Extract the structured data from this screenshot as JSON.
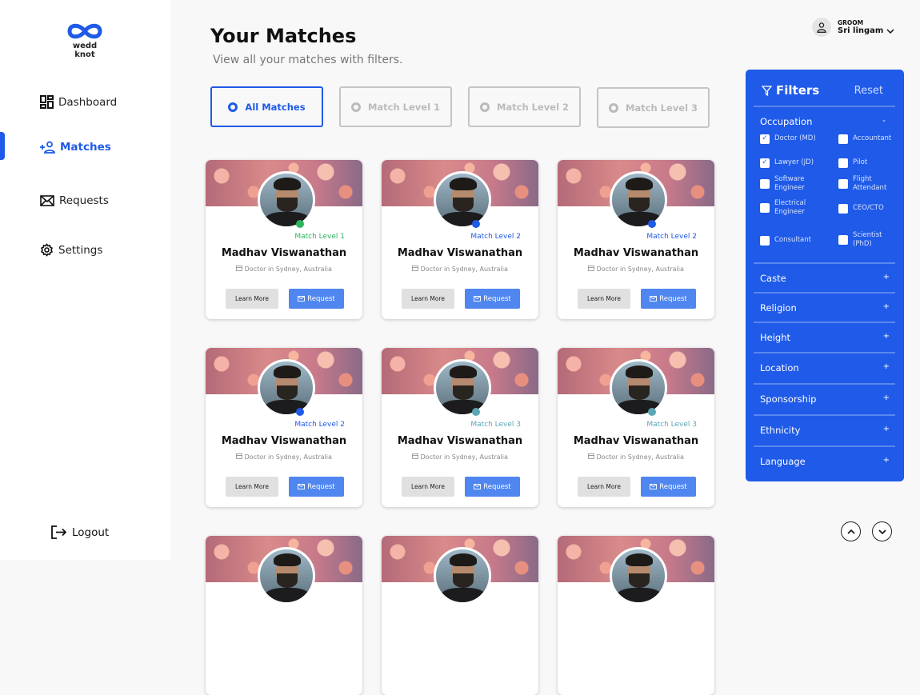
{
  "brand": {
    "name": "wedd knot",
    "color": "#1f5ae8"
  },
  "nav": [
    {
      "label": "Dashboard",
      "icon": "dashboard-icon"
    },
    {
      "label": "Matches",
      "icon": "add-user-icon",
      "active": true
    },
    {
      "label": "Requests",
      "icon": "mail-icon"
    },
    {
      "label": "Settings",
      "icon": "gear-icon"
    }
  ],
  "logout": "Logout",
  "header": {
    "title": "Your Matches",
    "subtitle": "View all your matches with filters."
  },
  "user": {
    "role": "GROOM",
    "name": "Sri lingam"
  },
  "tabs": [
    {
      "label": "All Matches",
      "active": true
    },
    {
      "label": "Match Level 1"
    },
    {
      "label": "Match Level 2"
    },
    {
      "label": "Match Level 3"
    }
  ],
  "level_colors": {
    "1": "#2db35d",
    "2": "#1f5ae8",
    "3": "#5aa8b5"
  },
  "cards": [
    {
      "name": "Madhav Viswanathan",
      "location": "Doctor in Sydney, Australia",
      "level": 1,
      "level_label": "Match Level 1"
    },
    {
      "name": "Madhav Viswanathan",
      "location": "Doctor in Sydney, Australia",
      "level": 2,
      "level_label": "Match Level 2"
    },
    {
      "name": "Madhav Viswanathan",
      "location": "Doctor in Sydney, Australia",
      "level": 2,
      "level_label": "Match Level 2"
    },
    {
      "name": "Madhav Viswanathan",
      "location": "Doctor in Sydney, Australia",
      "level": 2,
      "level_label": "Match Level 2"
    },
    {
      "name": "Madhav Viswanathan",
      "location": "Doctor in Sydney, Australia",
      "level": 3,
      "level_label": "Match Level 3"
    },
    {
      "name": "Madhav Viswanathan",
      "location": "Doctor in Sydney, Australia",
      "level": 3,
      "level_label": "Match Level 3"
    }
  ],
  "card_buttons": {
    "learn_more": "Learn More",
    "request": "Request"
  },
  "filters": {
    "title": "Filters",
    "reset": "Reset",
    "occupation": {
      "label": "Occupation",
      "toggle": "-",
      "options": [
        {
          "label": "Doctor (MD)",
          "checked": true
        },
        {
          "label": "Accountant",
          "checked": false
        },
        {
          "label": "Lawyer (JD)",
          "checked": true
        },
        {
          "label": "Pilot",
          "checked": false
        },
        {
          "label": "Software Engineer",
          "checked": false
        },
        {
          "label": "Flight Attendant",
          "checked": false
        },
        {
          "label": "Electrical Engineer",
          "checked": false
        },
        {
          "label": "CEO/CTO",
          "checked": false
        },
        {
          "label": "Consultant",
          "checked": false
        },
        {
          "label": "Scientist (PhD)",
          "checked": false
        }
      ]
    },
    "sections": [
      "Caste",
      "Religion",
      "Height",
      "Location",
      "Sponsorship",
      "Ethnicity",
      "Language"
    ],
    "expand": "+"
  }
}
